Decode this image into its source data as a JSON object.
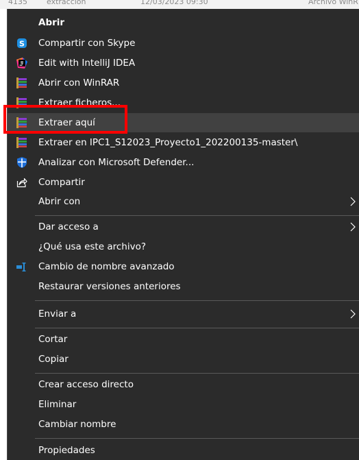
{
  "background_window": {
    "row_text": [
      "4135",
      "extracción",
      "12/03/2023 09:30",
      "Archivo WinR"
    ]
  },
  "menu": {
    "items": [
      {
        "label": "Abrir"
      },
      {
        "label": "Compartir con Skype",
        "icon": "skype-icon"
      },
      {
        "label": "Edit with IntelliJ IDEA",
        "icon": "intellij-icon"
      },
      {
        "label": "Abrir con WinRAR",
        "icon": "winrar-icon"
      },
      {
        "label": "Extraer ficheros...",
        "icon": "winrar-icon"
      },
      {
        "label": "Extraer aquí",
        "icon": "winrar-icon"
      },
      {
        "label": "Extraer en IPC1_S12023_Proyecto1_202200135-master\\",
        "icon": "winrar-icon"
      },
      {
        "label": "Analizar con Microsoft Defender...",
        "icon": "defender-shield-icon"
      },
      {
        "label": "Compartir",
        "icon": "share-icon"
      },
      {
        "label": "Abrir con",
        "submenu": true
      },
      {
        "label": "Dar acceso a",
        "submenu": true
      },
      {
        "label": "¿Qué usa este archivo?"
      },
      {
        "label": "Cambio de nombre avanzado",
        "icon": "rename-icon"
      },
      {
        "label": "Restaurar versiones anteriores"
      },
      {
        "label": "Enviar a",
        "submenu": true
      },
      {
        "label": "Cortar"
      },
      {
        "label": "Copiar"
      },
      {
        "label": "Crear acceso directo"
      },
      {
        "label": "Eliminar"
      },
      {
        "label": "Cambiar nombre"
      },
      {
        "label": "Propiedades"
      }
    ],
    "hovered_item": "Extraer aquí"
  },
  "colors": {
    "menu_bg": "#2b2b2b",
    "hover_bg": "#414141",
    "separator": "#5a5a5a",
    "highlight_box": "#ff0000",
    "skype": "#1e8fe1",
    "defender": "#1e6fd9",
    "rename": "#2a8dd6"
  }
}
